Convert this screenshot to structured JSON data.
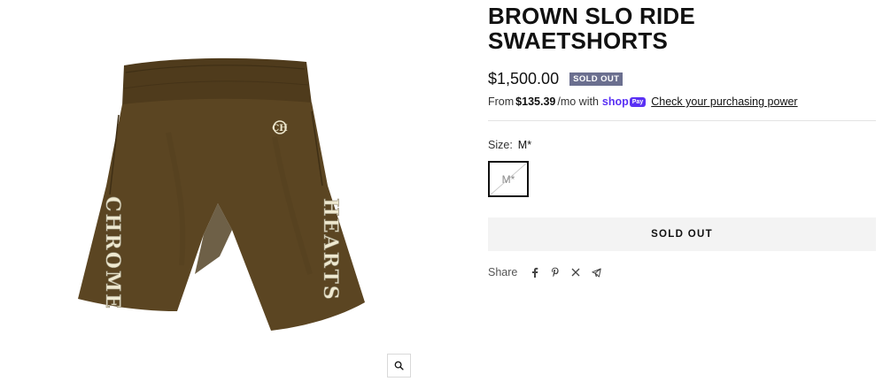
{
  "product": {
    "title_line1": "BROWN SLO RIDE",
    "title_line2": "SWAETSHORTS",
    "price": "$1,500.00",
    "badge": "SOLD OUT"
  },
  "installments": {
    "prefix": "From",
    "amount": "$135.39",
    "suffix": "/mo with",
    "shop_word": "shop",
    "pay_pill": "Pay",
    "link_text": "Check your purchasing power"
  },
  "size": {
    "label": "Size:",
    "selected": "M*",
    "options": [
      "M*"
    ]
  },
  "button": {
    "label": "SOLD OUT"
  },
  "share": {
    "label": "Share",
    "icons": [
      "facebook-icon",
      "pinterest-icon",
      "x-icon",
      "telegram-icon"
    ]
  },
  "image": {
    "left_text": "CHROME",
    "right_text": "HEARTS",
    "logo_mark": "CH"
  },
  "colors": {
    "shorts": "#5b4522",
    "print": "#efe9d0",
    "badge": "#6b6f8f",
    "shop_pay": "#5a31f4",
    "button_bg": "#f3f3f3"
  }
}
